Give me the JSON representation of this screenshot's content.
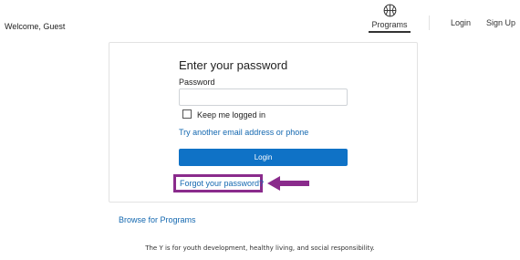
{
  "header": {
    "welcome": "Welcome, Guest",
    "nav": {
      "programs": "Programs",
      "programs_icon": "basketball-icon",
      "login": "Login",
      "signup": "Sign Up"
    }
  },
  "login_card": {
    "title": "Enter your password",
    "password_label": "Password",
    "password_value": "",
    "keep_logged_in_label": "Keep me logged in",
    "keep_logged_in_checked": false,
    "alt_link": "Try another email address or phone",
    "login_button": "Login",
    "forgot_link": "Forgot your password?",
    "annotation_icon": "arrow-left-icon"
  },
  "browse_link": "Browse for Programs",
  "footer": "The Y is for youth development, healthy living, and social responsibility.",
  "colors": {
    "link": "#1468b0",
    "button": "#0f72c6",
    "highlight": "#8a2b8c"
  }
}
